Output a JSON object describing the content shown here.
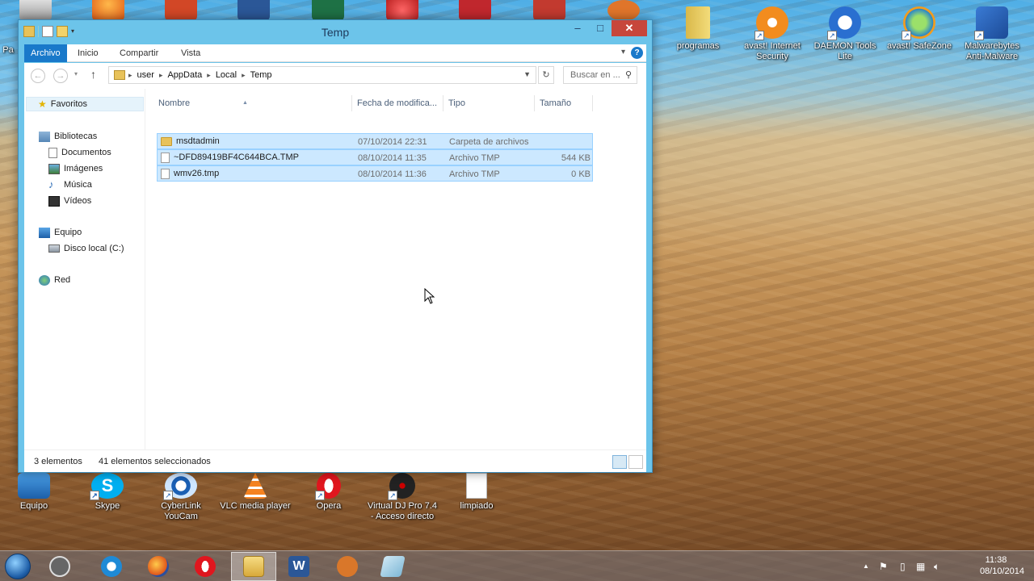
{
  "window": {
    "title": "Temp",
    "controls": {
      "minimize": "–",
      "maximize": "□",
      "close": "✕"
    },
    "ribbon_tabs": [
      "Archivo",
      "Inicio",
      "Compartir",
      "Vista"
    ],
    "address": {
      "segments": [
        "user",
        "AppData",
        "Local",
        "Temp"
      ],
      "search_placeholder": "Buscar en ..."
    },
    "nav": {
      "favorites": "Favoritos",
      "libraries": "Bibliotecas",
      "library_items": [
        "Documentos",
        "Imágenes",
        "Música",
        "Vídeos"
      ],
      "computer": "Equipo",
      "drive": "Disco local (C:)",
      "network": "Red"
    },
    "columns": {
      "name": "Nombre",
      "date": "Fecha de modifica...",
      "type": "Tipo",
      "size": "Tamaño"
    },
    "files": [
      {
        "name": "msdtadmin",
        "date": "07/10/2014 22:31",
        "type": "Carpeta de archivos",
        "size": "",
        "kind": "folder"
      },
      {
        "name": "~DFD89419BF4C644BCA.TMP",
        "date": "08/10/2014 11:35",
        "type": "Archivo TMP",
        "size": "544 KB",
        "kind": "file"
      },
      {
        "name": "wmv26.tmp",
        "date": "08/10/2014 11:36",
        "type": "Archivo TMP",
        "size": "0 KB",
        "kind": "file"
      }
    ],
    "status": {
      "count": "3 elementos",
      "selected": "41 elementos seleccionados"
    }
  },
  "desktop": {
    "right_icons": [
      {
        "label": "programas",
        "icon": "folder-icon"
      },
      {
        "label": "avast! Internet Security",
        "icon": "avast-icon"
      },
      {
        "label": "DAEMON Tools Lite",
        "icon": "daemon-tools-icon"
      },
      {
        "label": "avast! SafeZone",
        "icon": "safezone-icon"
      },
      {
        "label": "Malwarebytes Anti-Malware",
        "icon": "malwarebytes-icon"
      }
    ],
    "bottom_icons": [
      {
        "label": "Equipo",
        "icon": "computer-icon"
      },
      {
        "label": "Skype",
        "icon": "skype-icon"
      },
      {
        "label": "CyberLink YouCam",
        "icon": "youcam-icon"
      },
      {
        "label": "VLC media player",
        "icon": "vlc-icon"
      },
      {
        "label": "Opera",
        "icon": "opera-icon"
      },
      {
        "label": "Virtual DJ Pro 7.4 - Acceso directo",
        "icon": "virtualdj-icon"
      },
      {
        "label": "limpiado",
        "icon": "text-file-icon"
      }
    ],
    "left_clipped_label": "Pa"
  },
  "taskbar": {
    "clock_time": "11:38",
    "clock_date": "08/10/2014"
  },
  "colors": {
    "ribbon_file_tab": "#1979ca",
    "selection": "#cce8ff",
    "close_button": "#c7463b"
  }
}
